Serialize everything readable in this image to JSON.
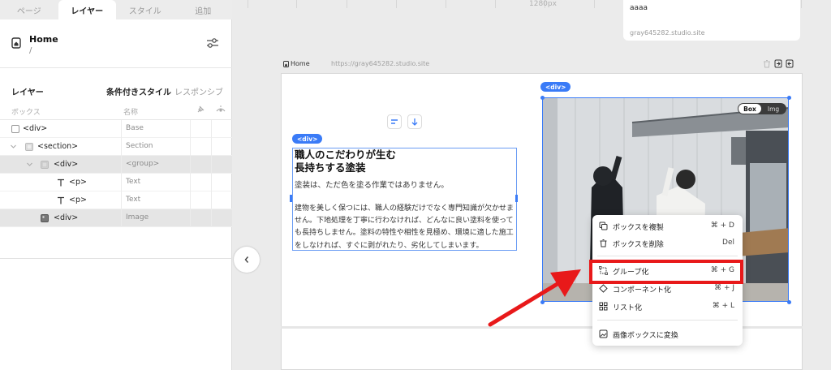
{
  "tabs": [
    {
      "label": "ページ",
      "active": false
    },
    {
      "label": "レイヤー",
      "active": true
    },
    {
      "label": "スタイル",
      "active": false
    },
    {
      "label": "追加",
      "active": false
    }
  ],
  "page": {
    "name": "Home",
    "path": "/"
  },
  "layers_panel": {
    "title": "レイヤー",
    "mode_conditional": "条件付きスタイル",
    "mode_responsive": "レスポンシブ",
    "col_box": "ボックス",
    "col_name": "名称",
    "rows": [
      {
        "label": "<div>",
        "name": "Base"
      },
      {
        "label": "<section>",
        "name": "Section"
      },
      {
        "label": "<div>",
        "name": "<group>"
      },
      {
        "label": "<p>",
        "name": "Text"
      },
      {
        "label": "<p>",
        "name": "Text"
      },
      {
        "label": "<div>",
        "name": "Image"
      }
    ]
  },
  "canvas": {
    "ruler_label": "1280px",
    "preview_card": {
      "title": "aaaa",
      "url": "gray645282.studio.site"
    },
    "frame_bar": {
      "page": "Home",
      "url": "https://gray645282.studio.site"
    },
    "div_tag": "<div>",
    "heading": "職人のこだわりが生む\n長持ちする塗装",
    "lead": "塗装は、ただ色を塗る作業ではありません。",
    "body": "建物を美しく保つには、職人の経験だけでなく専門知識が欠かせません。下地処理を丁寧に行わなければ、どんなに良い塗料を使っても長持ちしません。塗料の特性や相性を見極め、環境に適した施工をしなければ、すぐに剥がれたり、劣化してしまいます。",
    "toggle": {
      "on": "Box",
      "off": "Img"
    }
  },
  "context_menu": {
    "items": [
      {
        "label": "ボックスを複製",
        "shortcut": "⌘ + D"
      },
      {
        "label": "ボックスを削除",
        "shortcut": "Del"
      },
      {
        "label": "グループ化",
        "shortcut": "⌘ + G"
      },
      {
        "label": "コンポーネント化",
        "shortcut": "⌘ + J"
      },
      {
        "label": "リスト化",
        "shortcut": "⌘ + L"
      },
      {
        "label": "画像ボックスに変換",
        "shortcut": ""
      }
    ]
  },
  "colors": {
    "accent": "#3a7bf7",
    "highlight": "#e8191a"
  }
}
